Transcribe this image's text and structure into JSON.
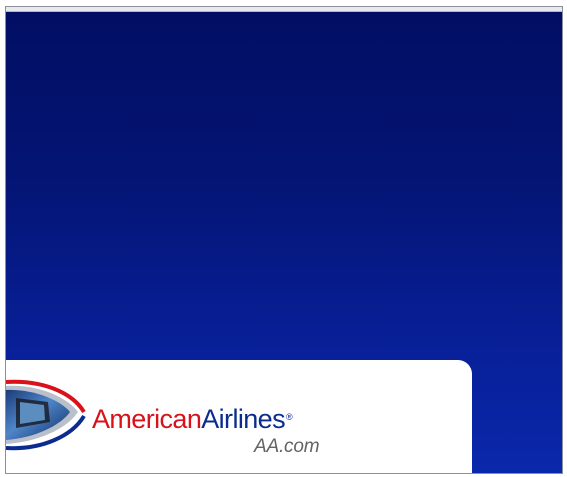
{
  "ad": {
    "brand_part1": "American",
    "brand_part2": "Airlines",
    "registered_mark": "®",
    "url": "AA.com"
  },
  "colors": {
    "background_top": "#020e63",
    "background_bottom": "#0a28ab",
    "brand_red": "#d9111b",
    "brand_blue": "#0a2c8f",
    "url_gray": "#606466"
  },
  "icons": {
    "plane": "plane-nose-icon"
  }
}
